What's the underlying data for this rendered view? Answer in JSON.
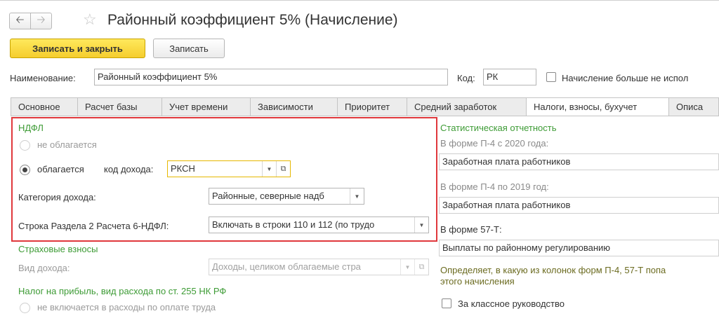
{
  "window": {
    "title": "Районный коэффициент 5% (Начисление)"
  },
  "toolbar": {
    "save_close_label": "Записать и закрыть",
    "save_label": "Записать"
  },
  "header": {
    "name_label": "Наименование:",
    "name_value": "Районный коэффициент 5%",
    "code_label": "Код:",
    "code_value": "РК",
    "not_used_label": "Начисление больше не испол"
  },
  "tabs": [
    {
      "label": "Основное",
      "active": false
    },
    {
      "label": "Расчет базы",
      "active": false
    },
    {
      "label": "Учет времени",
      "active": false
    },
    {
      "label": "Зависимости",
      "active": false
    },
    {
      "label": "Приоритет",
      "active": false
    },
    {
      "label": "Средний заработок",
      "active": false
    },
    {
      "label": "Налоги, взносы, бухучет",
      "active": true
    },
    {
      "label": "Описа",
      "active": false
    }
  ],
  "ndfl": {
    "section_title": "НДФЛ",
    "not_taxed_label": "не облагается",
    "taxed_label": "облагается",
    "income_code_label": "код дохода:",
    "income_code_value": "РКСН",
    "income_category_label": "Категория дохода:",
    "income_category_value": "Районные, северные надб",
    "row_6ndfl_label": "Строка Раздела 2 Расчета 6-НДФЛ:",
    "row_6ndfl_value": "Включать в строки 110 и 112 (по трудо"
  },
  "insurance": {
    "section_title": "Страховые взносы",
    "income_type_label": "Вид дохода:",
    "income_type_value": "Доходы, целиком облагаемые стра"
  },
  "profit_tax": {
    "section_title": "Налог на прибыль, вид расхода по ст. 255 НК РФ",
    "option_label": "не включается в расходы по оплате труда"
  },
  "statistics": {
    "section_title": "Статистическая отчетность",
    "p4_2020_label": "В форме П-4 с 2020 года:",
    "p4_2020_value": "Заработная плата работников",
    "p4_2019_label": "В форме П-4 по 2019 год:",
    "p4_2019_value": "Заработная плата работников",
    "f57t_label": "В форме 57-Т:",
    "f57t_value": "Выплаты по районному регулированию",
    "hint_line1": "Определяет, в какую из колонок форм П-4, 57-Т попа",
    "hint_line2": "этого начисления",
    "class_guidance_label": "За классное руководство"
  },
  "icons": {
    "back": "arrow-left-icon",
    "forward": "arrow-right-icon",
    "favorite": "star-icon",
    "dropdown": "chevron-down-icon",
    "open": "open-form-icon"
  },
  "colors": {
    "accent_yellow": "#f5cd2e",
    "section_green": "#3d9b35",
    "highlight_red": "#e0383c"
  }
}
